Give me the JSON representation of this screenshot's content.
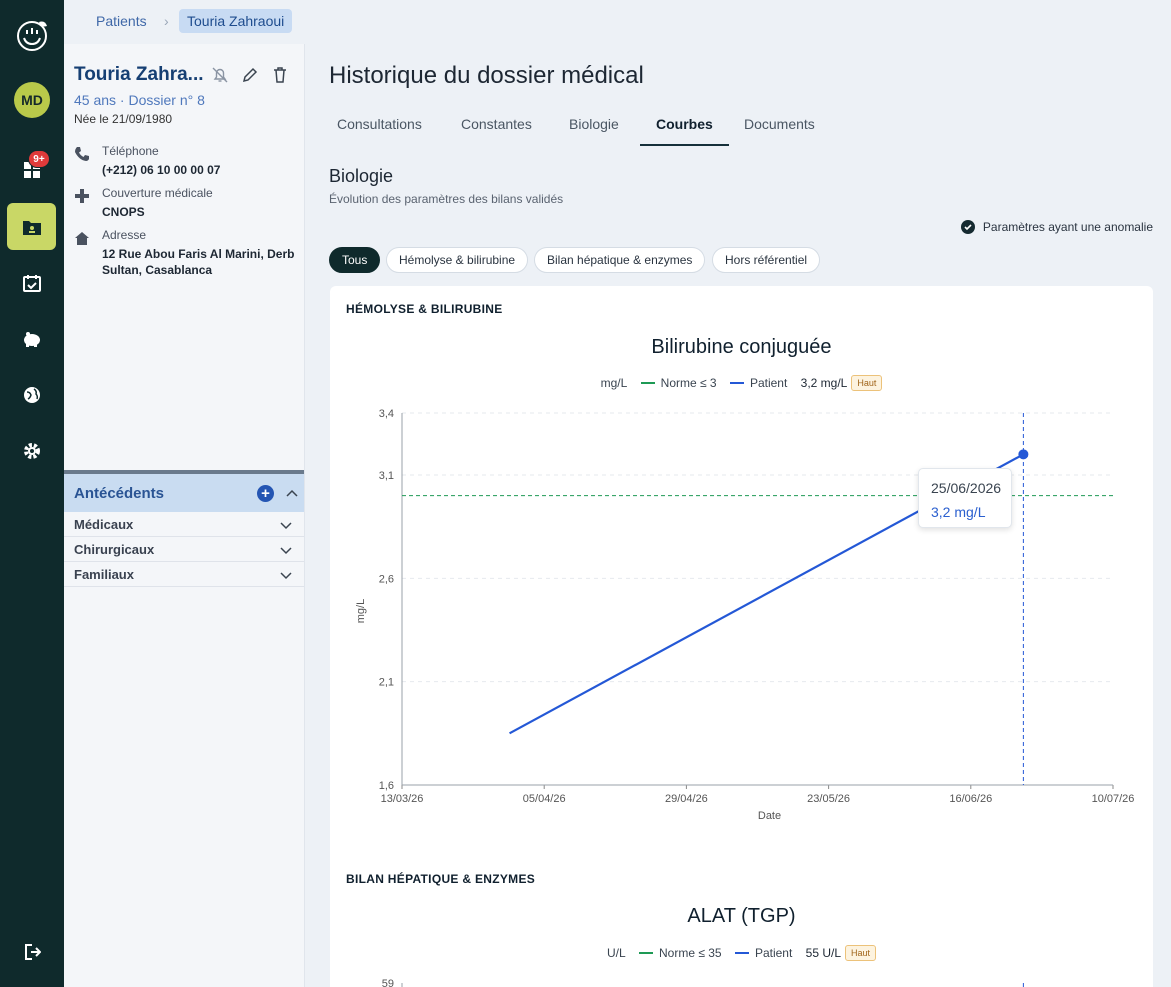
{
  "nav": {
    "avatar_initials": "MD",
    "badge_count": "9+",
    "items": [
      "logo-icon",
      "dashboard-icon",
      "patient-file-icon",
      "calendar-icon",
      "piggy-bank-icon",
      "globe-icon",
      "settings-icon",
      "logout-icon"
    ],
    "active_color": "#c9d766",
    "bg_color": "#0f2a2c"
  },
  "breadcrumb": {
    "root": "Patients",
    "current": "Touria Zahraoui"
  },
  "patient": {
    "name": "Touria Zahra...",
    "age_file": "45 ans · Dossier n° 8",
    "born": "Née le 21/09/1980",
    "phone_label": "Téléphone",
    "phone": "(+212) 06 10 00 00 07",
    "coverage_label": "Couverture médicale",
    "coverage": "CNOPS",
    "address_label": "Adresse",
    "address": "12 Rue Abou Faris Al Marini, Derb Sultan, Casablanca"
  },
  "antecedents": {
    "title": "Antécédents",
    "items": [
      "Médicaux",
      "Chirurgicaux",
      "Familiaux"
    ]
  },
  "main": {
    "title": "Historique du dossier médical",
    "tabs": [
      "Consultations",
      "Constantes",
      "Biologie",
      "Courbes",
      "Documents"
    ],
    "active_tab": "Courbes",
    "section_title": "Biologie",
    "section_subtitle": "Évolution des paramètres des bilans validés",
    "anomaly_toggle": "Paramètres ayant une anomalie",
    "filters": [
      "Tous",
      "Hémolyse & bilirubine",
      "Bilan hépatique & enzymes",
      "Hors référentiel"
    ],
    "active_filter": "Tous"
  },
  "chart_data": [
    {
      "type": "line",
      "group": "HÉMOLYSE & BILIRUBINE",
      "title": "Bilirubine conjuguée",
      "unit": "mg/L",
      "legend": {
        "norm": "Norme ≤ 3",
        "patient": "Patient",
        "last_value": "3,2 mg/L",
        "flag": "Haut"
      },
      "xlabel": "Date",
      "ylabel": "mg/L",
      "x_ticks": [
        "13/03/26",
        "05/04/26",
        "29/04/26",
        "23/05/26",
        "16/06/26",
        "10/07/26"
      ],
      "y_ticks": [
        "3,4",
        "3,1",
        "2,6",
        "2,1",
        "1,6"
      ],
      "ylim": [
        1.6,
        3.4
      ],
      "xlim": [
        "2026-03-13",
        "2026-07-10"
      ],
      "norm_value": 3.0,
      "series": [
        {
          "name": "Patient",
          "x": [
            "2026-03-31",
            "2026-06-25"
          ],
          "y": [
            1.85,
            3.2
          ]
        }
      ],
      "tooltip": {
        "date": "25/06/2026",
        "value": "3,2 mg/L"
      },
      "colors": {
        "patient": "#2458d6",
        "norm": "#1e9a55"
      }
    },
    {
      "type": "line",
      "group": "BILAN HÉPATIQUE & ENZYMES",
      "title": "ALAT (TGP)",
      "unit": "U/L",
      "legend": {
        "norm": "Norme ≤ 35",
        "patient": "Patient",
        "last_value": "55 U/L",
        "flag": "Haut"
      },
      "y_ticks": [
        "59"
      ],
      "colors": {
        "patient": "#2458d6",
        "norm": "#1e9a55"
      }
    }
  ]
}
